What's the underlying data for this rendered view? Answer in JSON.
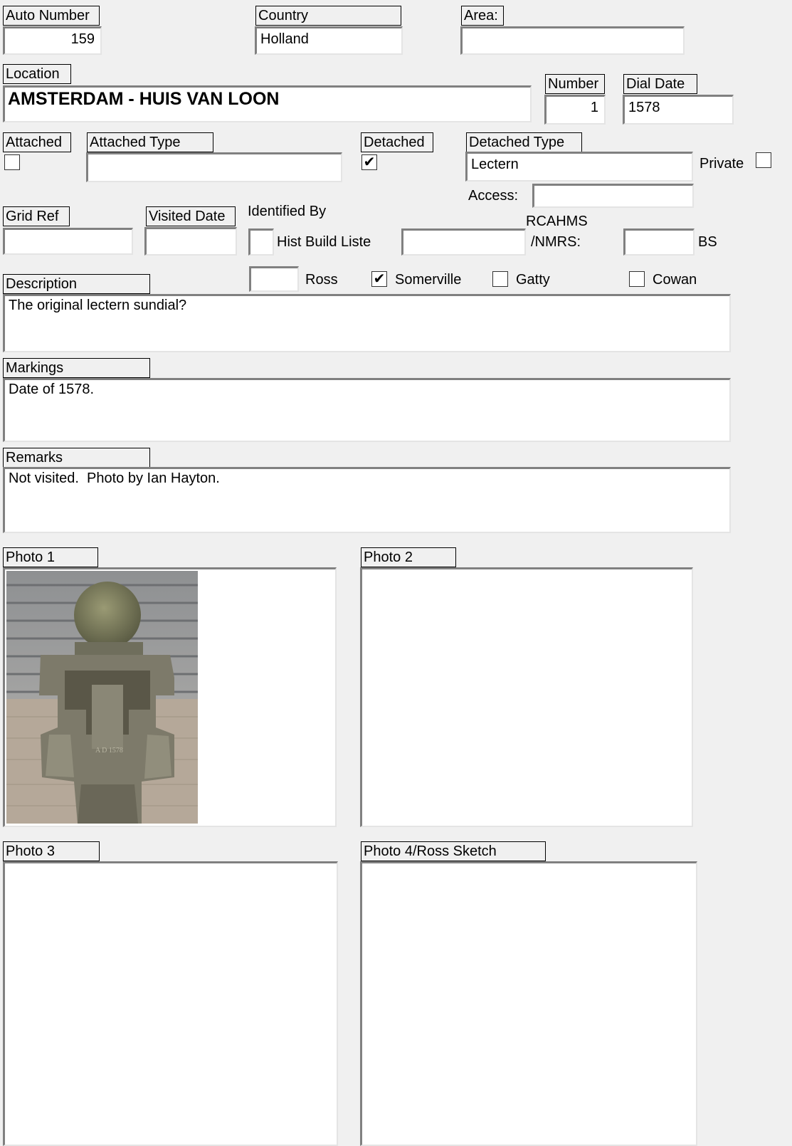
{
  "auto_number": {
    "label": "Auto Number",
    "value": "159"
  },
  "country": {
    "label": "Country",
    "value": "Holland"
  },
  "area": {
    "label": "Area:",
    "value": ""
  },
  "location": {
    "label": "Location",
    "value": "AMSTERDAM - HUIS VAN LOON"
  },
  "number": {
    "label": "Number",
    "value": "1"
  },
  "dial_date": {
    "label": "Dial Date",
    "value": "1578"
  },
  "attached": {
    "label": "Attached",
    "checked": false,
    "mark": ""
  },
  "attached_type": {
    "label": "Attached Type",
    "value": ""
  },
  "detached": {
    "label": "Detached",
    "checked": true,
    "mark": "✔"
  },
  "detached_type": {
    "label": "Detached Type",
    "value": "Lectern"
  },
  "private": {
    "label": "Private",
    "checked": false,
    "mark": ""
  },
  "access": {
    "label": "Access:",
    "value": ""
  },
  "grid_ref": {
    "label": "Grid Ref",
    "value": ""
  },
  "visited_date": {
    "label": "Visited Date",
    "value": ""
  },
  "identified_by": {
    "label": "Identified By",
    "hist_build_liste": {
      "label": "Hist Build Liste",
      "value": ""
    },
    "rcahms_label_1": "RCAHMS",
    "rcahms_label_2": "/NMRS:",
    "rcahms_value": "",
    "bs": {
      "label": "BS",
      "value": ""
    },
    "ross": {
      "label": "Ross",
      "value": ""
    },
    "somerville": {
      "label": "Somerville",
      "checked": true,
      "mark": "✔"
    },
    "gatty": {
      "label": "Gatty",
      "checked": false,
      "mark": ""
    },
    "cowan": {
      "label": "Cowan",
      "checked": false,
      "mark": ""
    }
  },
  "description": {
    "label": "Description",
    "value": "The original lectern sundial?"
  },
  "markings": {
    "label": "Markings",
    "value": "Date of 1578."
  },
  "remarks": {
    "label": "Remarks",
    "value": "Not visited.  Photo by Ian Hayton."
  },
  "photos": [
    {
      "label": "Photo 1",
      "has_image": true
    },
    {
      "label": "Photo 2",
      "has_image": false
    },
    {
      "label": "Photo 3",
      "has_image": false
    },
    {
      "label": "Photo 4/Ross Sketch",
      "has_image": false
    }
  ],
  "colors": {
    "background": "#f0f0f0",
    "field": "#ffffff",
    "border": "#808080"
  }
}
